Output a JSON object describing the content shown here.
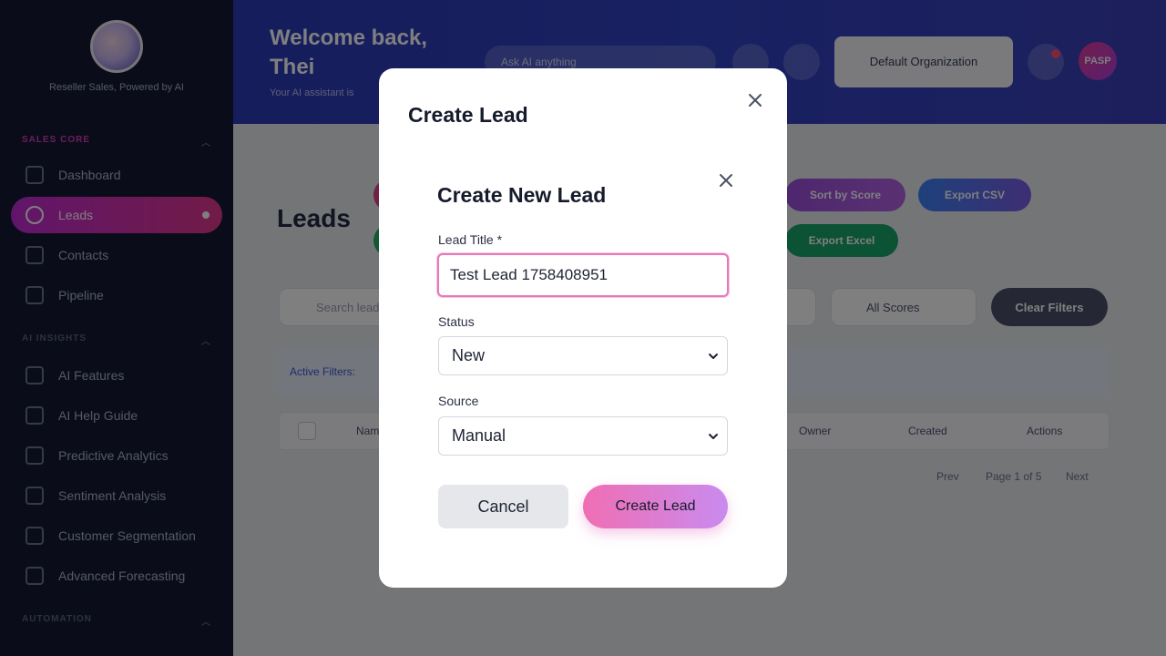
{
  "sidebar": {
    "brand_text": "Reseller Sales, Powered by AI",
    "sections": {
      "sales": "SALES CORE",
      "ai": "AI INSIGHTS",
      "automation": "AUTOMATION"
    },
    "items": [
      {
        "label": "Dashboard"
      },
      {
        "label": "Leads"
      },
      {
        "label": "Contacts"
      },
      {
        "label": "Pipeline"
      },
      {
        "label": "AI Features"
      },
      {
        "label": "AI Help Guide"
      },
      {
        "label": "Predictive Analytics"
      },
      {
        "label": "Sentiment Analysis"
      },
      {
        "label": "Customer Segmentation"
      },
      {
        "label": "Advanced Forecasting"
      }
    ]
  },
  "header": {
    "welcome": "Welcome back, Thei",
    "subtitle": "Your AI assistant is",
    "search_placeholder": "Ask AI anything",
    "org_label": "Default Organization",
    "avatar_initials": "PASP"
  },
  "page": {
    "title": "Leads",
    "sort_label": "Sort by Score",
    "export_csv": "Export CSV",
    "export_excel": "Export Excel",
    "search_placeholder": "Search leads",
    "scores_filter": "All Scores",
    "clear_filters": "Clear Filters",
    "active_filters": "Active Filters:",
    "columns": {
      "title": "Name",
      "owner": "Owner",
      "created": "Created",
      "actions": "Actions"
    },
    "pager": {
      "prev": "Prev",
      "page": "Page 1 of 5",
      "next": "Next"
    }
  },
  "modal_outer": {
    "title": "Create Lead"
  },
  "modal_inner": {
    "title": "Create New Lead",
    "lead_title_label": "Lead Title *",
    "lead_title_value": "Test Lead 1758408951",
    "status_label": "Status",
    "status_value": "New",
    "source_label": "Source",
    "source_value": "Manual",
    "cancel_label": "Cancel",
    "create_label": "Create Lead"
  },
  "colors": {
    "accent_pink": "#e879b7",
    "create_gradient_start": "#f06eb3",
    "create_gradient_end": "#c98bef",
    "sidebar_bg": "#151a33",
    "header_bg": "#3142c4"
  }
}
